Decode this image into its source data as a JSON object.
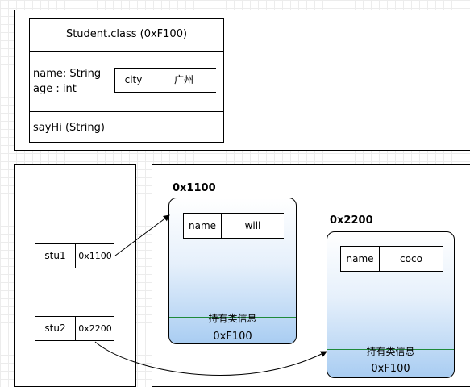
{
  "method_area": {
    "class_title": "Student.class  (0xF100)",
    "field1": "name: String",
    "field2": "age : int",
    "static_key": "city",
    "static_value": "广州",
    "method": "sayHi (String)"
  },
  "stack": {
    "vars": [
      {
        "name": "stu1",
        "value": "0x1100"
      },
      {
        "name": "stu2",
        "value": "0x2200"
      }
    ]
  },
  "heap": {
    "objects": [
      {
        "address": "0x1100",
        "field_name": "name",
        "field_value": "will",
        "class_info_label": "持有类信息",
        "class_address": "0xF100"
      },
      {
        "address": "0x2200",
        "field_name": "name",
        "field_value": "coco",
        "class_info_label": "持有类信息",
        "class_address": "0xF100"
      }
    ]
  },
  "colors": {
    "heap_fill_top": "#ffffff",
    "heap_fill_bottom": "#a9cdf2",
    "divider_green": "#1f8a3a"
  }
}
